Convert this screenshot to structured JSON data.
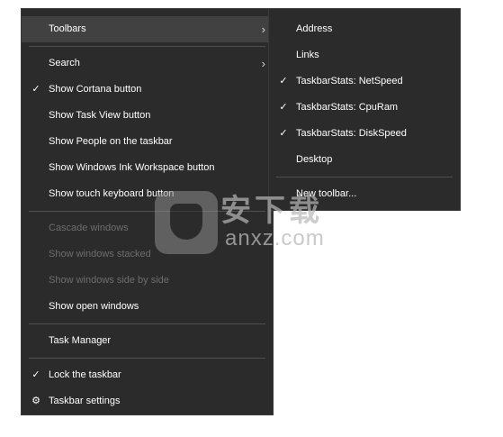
{
  "main_menu": {
    "toolbars": "Toolbars",
    "search": "Search",
    "show_cortana": "Show Cortana button",
    "show_task_view": "Show Task View button",
    "show_people": "Show People on the taskbar",
    "show_ink": "Show Windows Ink Workspace button",
    "show_touch_keyboard": "Show touch keyboard button",
    "cascade": "Cascade windows",
    "stacked": "Show windows stacked",
    "side_by_side": "Show windows side by side",
    "show_open": "Show open windows",
    "task_manager": "Task Manager",
    "lock_taskbar": "Lock the taskbar",
    "taskbar_settings": "Taskbar settings"
  },
  "sub_menu": {
    "address": "Address",
    "links": "Links",
    "netspeed": "TaskbarStats: NetSpeed",
    "cpuram": "TaskbarStats: CpuRam",
    "diskspeed": "TaskbarStats: DiskSpeed",
    "desktop": "Desktop",
    "new_toolbar": "New toolbar..."
  },
  "glyphs": {
    "check": "✓",
    "chevron": "›",
    "gear": "⚙"
  },
  "watermark": {
    "text": "安下载",
    "sub": "anxz.com"
  },
  "colors": {
    "menu_bg": "#2b2b2b",
    "text": "#ffffff",
    "disabled_text": "#6d6d6d",
    "highlight": "#414141"
  }
}
